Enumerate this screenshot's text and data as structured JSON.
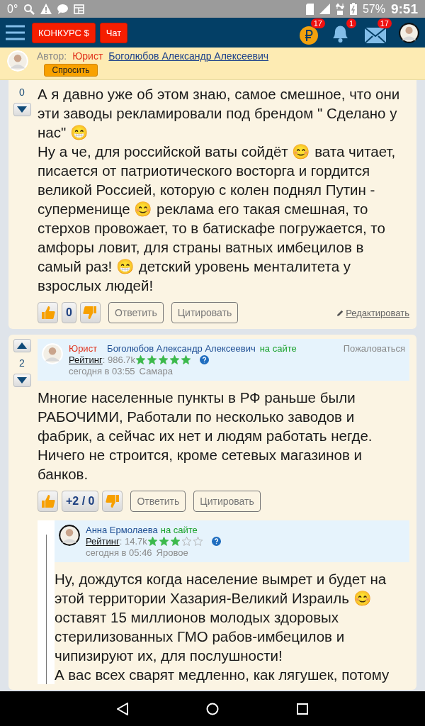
{
  "status_bar": {
    "temperature": "0°",
    "battery": "57%",
    "time": "9:51"
  },
  "app_bar": {
    "buttons": [
      "КОНКУРС $",
      "Чат"
    ],
    "coin_badge": "17",
    "bell_badge": "1",
    "mail_badge": "17"
  },
  "author_banner": {
    "label": "Автор:",
    "role": "Юрист",
    "name": "Боголюбов Александр Алексеевич",
    "button": "Спросить"
  },
  "posts": [
    {
      "votes": "0",
      "paragraphs": [
        "А я давно уже об этом знаю, самое смешное, что они эти заводы рекламировали под брендом \" Сделано у нас\" 😁",
        "Ну а че, для российской ваты сойдёт 😊 вата читает, писается от патриотического восторга и гордится великой Россией, которую с колен поднял Путин - суперменище 😊 реклама его такая смешная, то стерхов провожает, то в батискафе погружается, то амфоры ловит, для страны ватных имбецилов в самый раз! 😁 детский уровень менталитета у взрослых людей!"
      ],
      "actions": {
        "score": "0",
        "reply": "Ответить",
        "quote": "Цитировать",
        "edit": "Редактировать"
      }
    },
    {
      "votes": "2",
      "header": {
        "role": "Юрист",
        "name": "Боголюбов Александр Алексеевич",
        "status": "на сайте",
        "complain": "Пожаловаться",
        "rating_label": "Рейтинг",
        "rating": ": 986.7k",
        "stars": 5,
        "date": "сегодня в 03:55",
        "city": "Самара"
      },
      "paragraphs": [
        "Многие населенные пункты в РФ раньше были РАБОЧИМИ, Работали по несколько заводов и фабрик, а сейчас их нет и людям работать негде. Ничего не строится, кроме сетевых магазинов и банков."
      ],
      "actions": {
        "score": "+2 / 0",
        "reply": "Ответить",
        "quote": "Цитировать"
      },
      "replies": [
        {
          "name": "Анна Ермолаева",
          "status": "на сайте",
          "rating_label": "Рейтинг",
          "rating": ": 14.7k",
          "stars": 3,
          "date": "сегодня в 05:46",
          "city": "Яровое",
          "paragraphs": [
            "Ну, дождутся когда население вымрет и будет на этой территории Хазария-Великий Израиль 😊 оставят 15 миллионов молодых здоровых стерилизованных ГМО рабов-имбецилов и чипизируют их, для послушности!",
            "А вас всех сварят медленно, как лягушек, потому"
          ]
        }
      ]
    }
  ]
}
